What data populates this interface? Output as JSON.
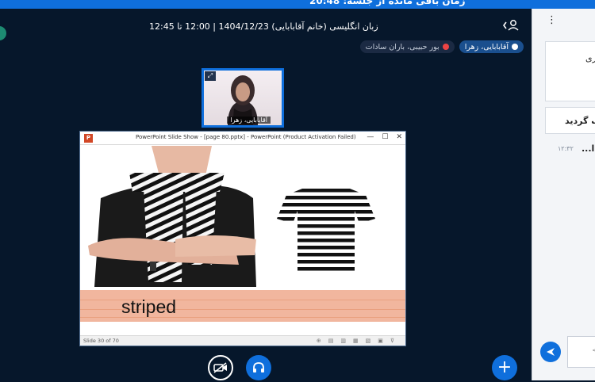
{
  "topbar": {
    "text": "زمان باقی مانده از جلسه: 20:48"
  },
  "meeting": {
    "title": "زبان انگلیسی (خانم آقابابایی) 1404/12/23 | 12:00 تا 12:45"
  },
  "talkers": [
    {
      "name": "آقابابایی، زهرا",
      "state": "active"
    },
    {
      "name": "بور حبیبی، باران سادات",
      "state": "inactive"
    }
  ],
  "webcam": {
    "name": "آقابابایی، زهرا"
  },
  "ppt": {
    "logo": "P",
    "title": "PowerPoint Slide Show - [page 80.pptx] - PowerPoint (Product Activation Failed)",
    "slide_word": "striped",
    "status": "Slide 30 of 70",
    "window_buttons": [
      "—",
      "☐",
      "✕"
    ]
  },
  "icons": {
    "camera": "camera-off-icon",
    "audio": "headphones-icon",
    "plus": "plus-icon",
    "send": "send-icon",
    "users": "users-icon",
    "kebab": "kebab-menu-icon"
  },
  "sidebar": {
    "card1_text": "ری",
    "card2_text": "ف گردید",
    "time": "۱۲:۳۲",
    "msg": "...ا"
  },
  "colors": {
    "accent": "#0f6fdc",
    "background": "#06172b"
  }
}
